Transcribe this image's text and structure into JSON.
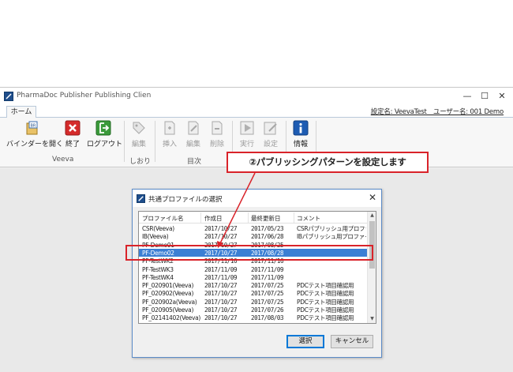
{
  "window": {
    "title": "PharmaDoc Publisher Publishing Client Ver",
    "controls": {
      "minimize": "—",
      "maximize": "☐",
      "close": "✕"
    },
    "config_label": "設定名: VeevaTest　ユーザー名: 001 Demo"
  },
  "ribbon": {
    "tab_home": "ホーム",
    "buttons": {
      "open_binder": "バインダーを開く",
      "exit": "終了",
      "logout": "ログアウト",
      "edit_bookmark": "編集",
      "insert": "挿入",
      "edit_toc": "編集",
      "delete": "削除",
      "run": "実行",
      "settings": "設定",
      "info": "情報"
    },
    "groups": {
      "veeva": "Veeva",
      "bookmark": "しおり",
      "toc": "目次"
    }
  },
  "callout": {
    "text": "②パブリッシングパターンを設定します"
  },
  "dialog": {
    "title": "共通プロファイルの選択",
    "close": "✕",
    "columns": [
      "プロファイル名",
      "作成日",
      "最終更新日",
      "コメント"
    ],
    "rows": [
      [
        "CSR(Veeva)",
        "2017/10/27",
        "2017/05/23",
        "CSRパブリッシュ用プロファイル"
      ],
      [
        "IB(Veeva)",
        "2017/10/27",
        "2017/06/28",
        "IBパブリッシュ用プロファイル(Ve"
      ],
      [
        "PF-Demo01",
        "2017/10/27",
        "2017/08/25",
        ""
      ],
      [
        "PF-Demo02",
        "2017/10/27",
        "2017/08/28",
        ""
      ],
      [
        "PF-TestWK2",
        "2017/11/16",
        "2017/11/16",
        ""
      ],
      [
        "PF-TestWK3",
        "2017/11/09",
        "2017/11/09",
        ""
      ],
      [
        "PF-TestWK4",
        "2017/11/09",
        "2017/11/09",
        ""
      ],
      [
        "PF_020901(Veeva)",
        "2017/10/27",
        "2017/07/25",
        "PDCテスト項目確認用"
      ],
      [
        "PF_020902(Veeva)",
        "2017/10/27",
        "2017/07/25",
        "PDCテスト項目確認用"
      ],
      [
        "PF_020902a(Veeva)",
        "2017/10/27",
        "2017/07/25",
        "PDCテスト項目確認用"
      ],
      [
        "PF_020905(Veeva)",
        "2017/10/27",
        "2017/07/26",
        "PDCテスト項目確認用"
      ],
      [
        "PF_02141402(Veeva)",
        "2017/10/27",
        "2017/08/03",
        "PDCテスト項目確認用"
      ]
    ],
    "selected_index": 3,
    "ok_label": "選択",
    "cancel_label": "キャンセル"
  },
  "colors": {
    "highlight": "#d9232a",
    "selection": "#3b7fd4"
  }
}
